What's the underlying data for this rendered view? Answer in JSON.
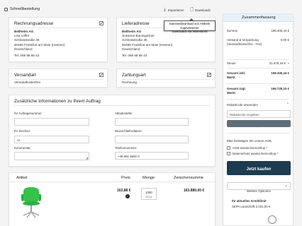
{
  "page": {
    "title": "Schnellbestellung",
    "export_label": "Exportieren",
    "downloads_label": "Downloads",
    "tooltip": {
      "line1": "Sammeldownload von Artikeln zugewiesener",
      "line2": "Downloads via Warenkorb"
    }
  },
  "billing": {
    "title": "Rechnungsadresse",
    "lines": [
      "Bellheim AG",
      "Lisa Löffel",
      "Schlossstraße 36",
      "60486 Frankfurt am Main (Hessen)",
      "Deutschland",
      "",
      "Tel: 069 98 68 43"
    ]
  },
  "shipping": {
    "title": "Lieferadresse",
    "lines": [
      "Bellheim AG",
      "Susanne Baumgartner",
      "Schlossstraße 36",
      "60486 Frankfurt am Main (Hessen)",
      "Deutschland",
      "",
      "Tel: 069 98 68 42"
    ]
  },
  "shipping_method": {
    "title": "Versandart",
    "value": "Versandkostenfrei"
  },
  "payment_method": {
    "title": "Zahlungsart",
    "value": "Rechnung"
  },
  "order_info": {
    "title": "Zusätzliche Informationen zu Ihrem Auftrag",
    "order_number_label": "Ihr Auftragsnummer:",
    "pickup_label": "Abladestelle:",
    "reference_label": "Ihr Zeichen:",
    "reference_value": "AI",
    "delivery_date_label": "Wunschlieferdatum:",
    "comment_label": "Kommentar:",
    "phone_label": "Telefonnummer:",
    "phone_value": "+49 661 9650 0"
  },
  "cart_table": {
    "headers": {
      "article": "Artikel",
      "price": "Preis",
      "qty": "Menge",
      "subtotal": "Zwischensumme"
    },
    "rows": [
      {
        "price": "163,88 €",
        "qty": "1000",
        "unit": "Stück",
        "subtotal": "163.880,00 €"
      }
    ]
  },
  "summary": {
    "title": "Zusammenfassung",
    "items": [
      {
        "label": "Summe",
        "value": "198.406,44 €"
      },
      {
        "label": "Versand & Verpackung (Versandkostenfrei - Frei)",
        "value": "0,00 €"
      },
      {
        "label": "Steuer",
        "value": "31.678,34 €"
      },
      {
        "label": "Gesamt inkl. MwSt.",
        "value": "198.406,44 €"
      },
      {
        "label": "Gesamt zzgl. MwSt.",
        "value": "166.728,10 €"
      }
    ],
    "rebate_label": "Rabattcode anwenden",
    "rebate_placeholder": "Rabattcode eingeben",
    "apply_label": "Anwenden",
    "agb_text": "Bitte bestätigen Sie unsere AGB.",
    "agb_checkbox": "AGB avanta Demoshop *",
    "privacy_checkbox": "Datenschutz avanta Demoshop *",
    "buy_label": "Jetzt kaufen",
    "more_options": "Weitere Optionen",
    "credit_title": "Ihr aktuelles Kreditlimit",
    "credit_value": "SEPA Lastschrift:2.031,00 €"
  },
  "colors": {
    "primary": "#1d3c50",
    "accent": "#e6f1f8",
    "grey_button": "#5f6d7a"
  }
}
